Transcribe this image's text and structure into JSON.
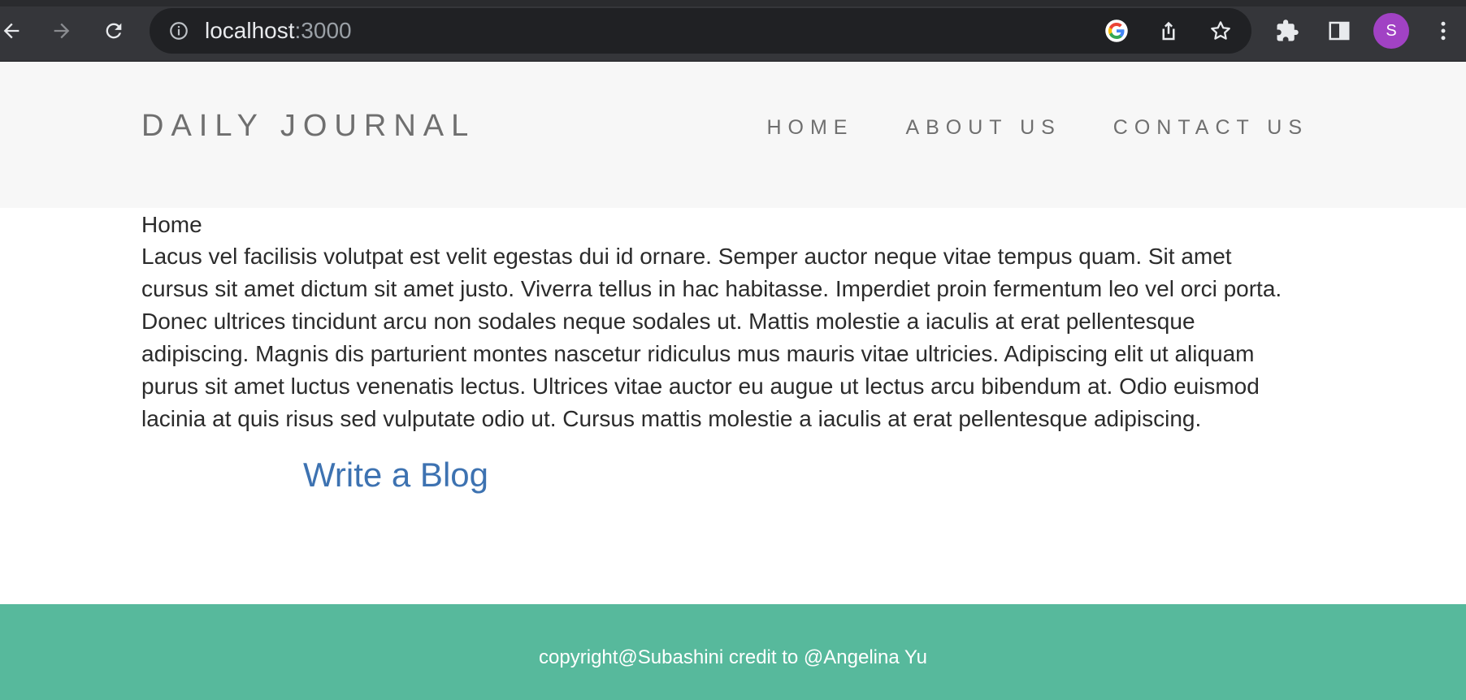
{
  "browser": {
    "url_host": "localhost",
    "url_port": ":3000",
    "profile_initial": "S",
    "icons": [
      "back-icon",
      "forward-icon",
      "reload-icon",
      "info-icon",
      "google-icon",
      "share-icon",
      "star-icon",
      "extensions-icon",
      "side-panel-icon",
      "menu-icon"
    ],
    "colors": {
      "chrome": "#35363a",
      "omnibox": "#202124",
      "avatar": "#a142c4"
    }
  },
  "header": {
    "brand": "DAILY JOURNAL",
    "nav": [
      {
        "label": "HOME"
      },
      {
        "label": "ABOUT US"
      },
      {
        "label": "CONTACT US"
      }
    ]
  },
  "main": {
    "heading": "Home",
    "body": "Lacus vel facilisis volutpat est velit egestas dui id ornare. Semper auctor neque vitae tempus quam. Sit amet cursus sit amet dictum sit amet justo. Viverra tellus in hac habitasse. Imperdiet proin fermentum leo vel orci porta. Donec ultrices tincidunt arcu non sodales neque sodales ut. Mattis molestie a iaculis at erat pellentesque adipiscing. Magnis dis parturient montes nascetur ridiculus mus mauris vitae ultricies. Adipiscing elit ut aliquam purus sit amet luctus venenatis lectus. Ultrices vitae auctor eu augue ut lectus arcu bibendum at. Odio euismod lacinia at quis risus sed vulputate odio ut. Cursus mattis molestie a iaculis at erat pellentesque adipiscing.",
    "write_link": "Write a Blog"
  },
  "footer": {
    "text": "copyright@Subashini credit to @Angelina Yu"
  },
  "colors": {
    "header_bg": "#f7f7f7",
    "link": "#3d72b1",
    "footer_bg": "#57b99c"
  }
}
